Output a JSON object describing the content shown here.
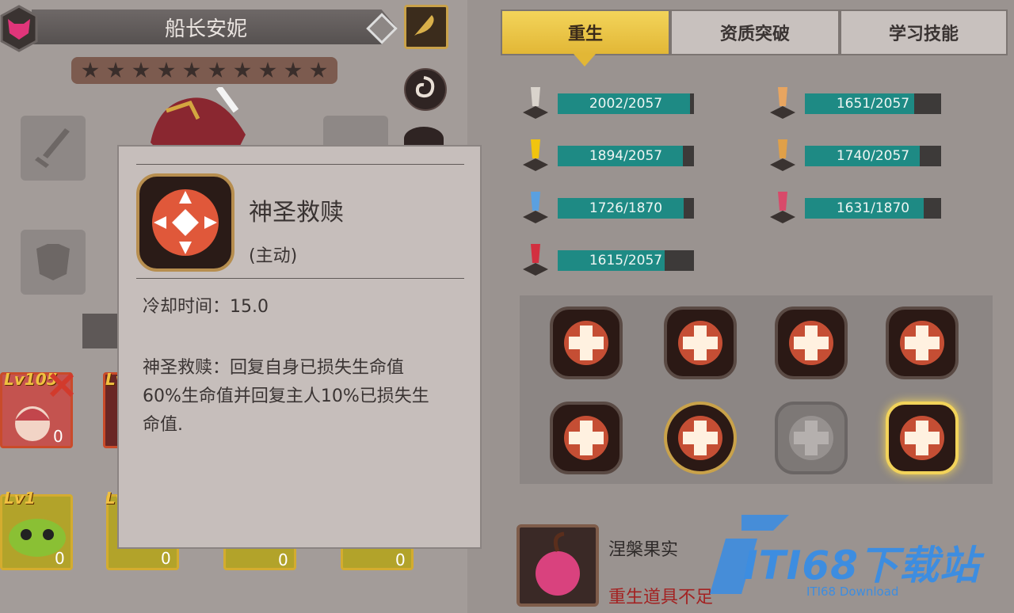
{
  "hero": {
    "name": "船长安妮",
    "star_count": 10
  },
  "tooltip": {
    "title": "神圣救赎",
    "type": "(主动)",
    "cooldown": "冷却时间：15.0",
    "description": "神圣救赎：回复自身已损失生命值60%生命值并回复主人10%已损失生命值."
  },
  "cards": [
    {
      "level": "Lv105",
      "count": "0"
    },
    {
      "level": "Lv",
      "count": ""
    },
    {
      "level": "Lv1",
      "count": "0"
    },
    {
      "level": "Lv",
      "count": "0"
    },
    {
      "level": "",
      "count": "0"
    },
    {
      "level": "",
      "count": "0"
    },
    {
      "level": "",
      "count": "0"
    }
  ],
  "tabs": {
    "rebirth": "重生",
    "breakthrough": "资质突破",
    "skills": "学习技能",
    "active": "rebirth"
  },
  "stats": [
    {
      "icon": "sword-icon",
      "text": "2002/2057",
      "value": 2002,
      "max": 2057
    },
    {
      "icon": "shield-icon",
      "text": "1651/2057",
      "value": 1651,
      "max": 2057
    },
    {
      "icon": "ankh-icon",
      "text": "1894/2057",
      "value": 1894,
      "max": 2057
    },
    {
      "icon": "armor-icon",
      "text": "1740/2057",
      "value": 1740,
      "max": 2057
    },
    {
      "icon": "crystal-icon",
      "text": "1726/1870",
      "value": 1726,
      "max": 1870
    },
    {
      "icon": "compass-icon",
      "text": "1631/1870",
      "value": 1631,
      "max": 1870
    },
    {
      "icon": "heart-icon",
      "text": "1615/2057",
      "value": 1615,
      "max": 2057
    }
  ],
  "skills": [
    "skill-strike-icon",
    "skill-blade-icon",
    "skill-claw-icon",
    "skill-cross-icon",
    "skill-star-shield-icon",
    "skill-paw-heal-icon",
    "skill-paw-locked-icon",
    "skill-holy-redemption-icon"
  ],
  "item": {
    "name": "涅槃果实",
    "warning": "重生道具不足"
  },
  "watermark": {
    "text": "ITI68下载站",
    "subtext": "ITI68 Download"
  }
}
